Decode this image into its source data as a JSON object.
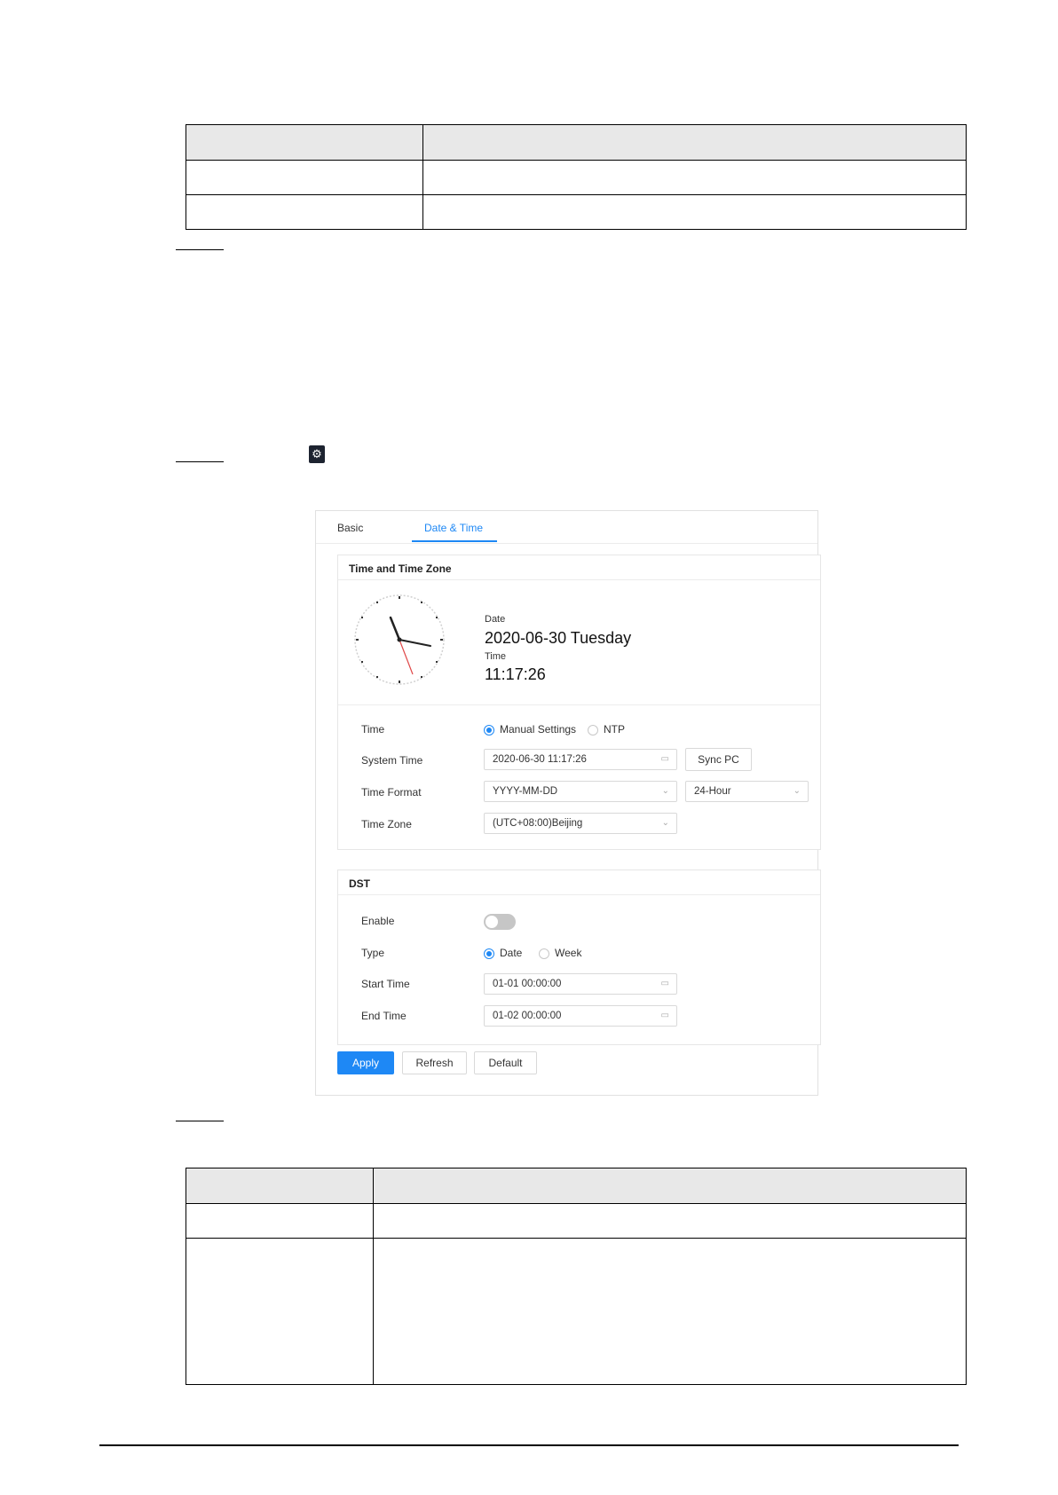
{
  "tabs": [
    {
      "label": "Basic"
    },
    {
      "label": "Date & Time"
    }
  ],
  "time_zone_section": {
    "title": "Time and Time Zone",
    "date_label": "Date",
    "date_value": "2020-06-30 Tuesday",
    "time_label": "Time",
    "time_value": "11:17:26"
  },
  "settings": {
    "time_label": "Time",
    "manual_label": "Manual Settings",
    "ntp_label": "NTP",
    "system_time_label": "System Time",
    "system_time_value": "2020-06-30 11:17:26",
    "sync_pc": "Sync PC",
    "time_format_label": "Time Format",
    "date_format_value": "YYYY-MM-DD",
    "hour_format_value": "24-Hour",
    "time_zone_label": "Time Zone",
    "time_zone_value": "(UTC+08:00)Beijing"
  },
  "dst": {
    "title": "DST",
    "enable_label": "Enable",
    "enabled": false,
    "type_label": "Type",
    "date_option": "Date",
    "week_option": "Week",
    "start_label": "Start Time",
    "start_value": "01-01 00:00:00",
    "end_label": "End Time",
    "end_value": "01-02 00:00:00"
  },
  "buttons": {
    "apply": "Apply",
    "refresh": "Refresh",
    "default": "Default"
  },
  "icons": {
    "settings": "gear-icon",
    "calendar": "calendar-icon",
    "dropdown": "chevron-down-icon"
  },
  "colors": {
    "accent": "#1e88f5"
  }
}
